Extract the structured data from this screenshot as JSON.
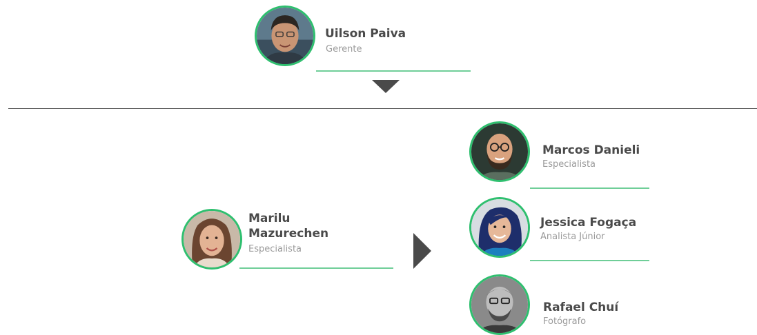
{
  "manager": {
    "name": "Uilson Paiva",
    "role": "Gerente",
    "avatar_icon": "person-photo-icon"
  },
  "lead": {
    "name_line1": "Marilu",
    "name_line2": "Mazurechen",
    "role": "Especialista",
    "avatar_icon": "person-photo-icon"
  },
  "team": [
    {
      "name": "Marcos Danieli",
      "role": "Especialista",
      "avatar_icon": "person-photo-icon"
    },
    {
      "name": "Jessica Fogaça",
      "role": "Analista Júnior",
      "avatar_icon": "person-photo-icon"
    },
    {
      "name": "Rafael Chuí",
      "role": "Fotógrafo",
      "avatar_icon": "person-photo-icon"
    }
  ],
  "colors": {
    "accent": "#2fbf6f",
    "underline": "#6fce98",
    "name_text": "#4a4a4a",
    "role_text": "#9a9a9a",
    "arrow": "#4a4a4a"
  }
}
